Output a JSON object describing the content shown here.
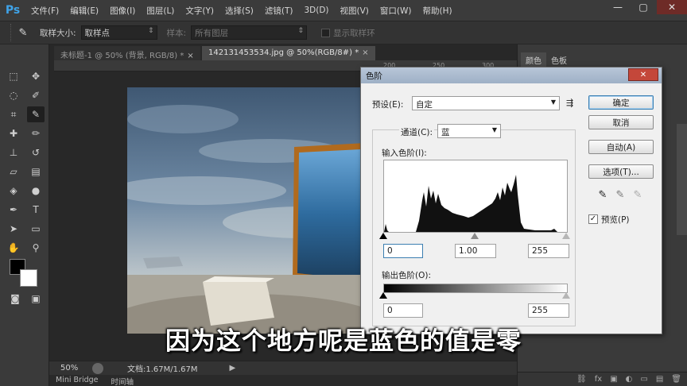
{
  "app": {
    "logo": "Ps",
    "menu": [
      "文件(F)",
      "编辑(E)",
      "图像(I)",
      "图层(L)",
      "文字(Y)",
      "选择(S)",
      "滤镜(T)",
      "3D(D)",
      "视图(V)",
      "窗口(W)",
      "帮助(H)"
    ],
    "window_controls": [
      "—",
      "▢",
      "✕"
    ]
  },
  "options_bar": {
    "sample_size_label": "取样大小:",
    "sample_size_value": "取样点",
    "sample_label": "样本:",
    "sample_value": "所有图层",
    "show_ring_label": "显示取样环"
  },
  "documents": {
    "tabs": [
      {
        "label": "未标题-1 @ 50% (背景, RGB/8) *",
        "active": false
      },
      {
        "label": "142131453534.jpg @ 50%(RGB/8#) *",
        "active": true
      }
    ],
    "ruler_ticks": [
      "200",
      "250",
      "300"
    ],
    "status": {
      "zoom": "50%",
      "doc_info": "文档:1.67M/1.67M"
    },
    "bottom_tabs": [
      "Mini Bridge",
      "时间轴"
    ]
  },
  "right_panel": {
    "tabs": [
      "颜色",
      "色板"
    ],
    "bottom_icons": [
      "⛓",
      "fx",
      "▣",
      "◐",
      "▭",
      "▤",
      "🗑"
    ]
  },
  "levels_dialog": {
    "title": "色阶",
    "close": "✕",
    "preset_label": "预设(E):",
    "preset_value": "自定",
    "channel_label": "通道(C):",
    "channel_value": "蓝",
    "input_levels_label": "输入色阶(I):",
    "input_black": "0",
    "input_gamma": "1.00",
    "input_white": "255",
    "output_levels_label": "输出色阶(O):",
    "output_black": "0",
    "output_white": "255",
    "buttons": {
      "ok": "确定",
      "cancel": "取消",
      "auto": "自动(A)",
      "options": "选项(T)..."
    },
    "preview_label": "预览(P)",
    "preview_checked": true
  },
  "subtitle": "因为这个地方呢是蓝色的值是零"
}
